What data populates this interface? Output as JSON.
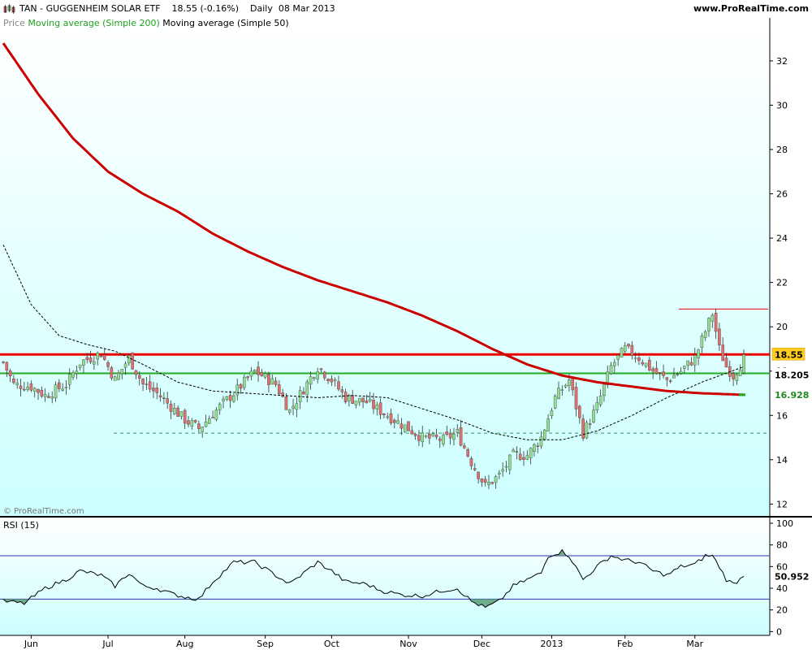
{
  "header": {
    "title": "TAN - GUGGENHEIM SOLAR ETF",
    "change": "18.55 (-0.16%)",
    "period": "Daily",
    "date": "08 Mar 2013",
    "brand": "www.ProRealTime.com"
  },
  "legend": {
    "price": "Price",
    "ma200": "Moving average (Simple 200)",
    "ma50": "Moving average (Simple 50)"
  },
  "watermark": "© ProRealTime.com",
  "colors": {
    "background_top": "#ffffff",
    "background_bottom": "#ccffff",
    "ma200": "#cc0000",
    "ma50": "#000000",
    "up_candle": "#90e090",
    "down_candle": "#e07070",
    "resistance": "#ee0000",
    "support": "#22aa22",
    "rsi_line": "#000000",
    "rsi_fill": "#5a9e7a"
  },
  "chart_data": [
    {
      "type": "candlestick",
      "name": "price",
      "y_ticks": [
        12,
        14,
        16,
        18,
        20,
        22,
        24,
        26,
        28,
        30,
        32
      ],
      "ylim": [
        11.5,
        33.5
      ],
      "x_ticks": [
        "Jun",
        "Jul",
        "Aug",
        "Sep",
        "Oct",
        "Nov",
        "Dec",
        "2013",
        "Feb",
        "Mar"
      ],
      "last_price": "18.55",
      "ma_label": "18.205",
      "support_label": "16.928",
      "closes_anchor": [
        [
          0,
          18.4
        ],
        [
          3,
          17.4
        ],
        [
          8,
          17.3
        ],
        [
          12,
          16.9
        ],
        [
          18,
          17.4
        ],
        [
          22,
          18.4
        ],
        [
          28,
          18.8
        ],
        [
          32,
          17.6
        ],
        [
          36,
          18.6
        ],
        [
          40,
          17.4
        ],
        [
          44,
          17.0
        ],
        [
          48,
          16.4
        ],
        [
          52,
          15.8
        ],
        [
          56,
          15.4
        ],
        [
          62,
          16.4
        ],
        [
          66,
          17.0
        ],
        [
          72,
          18.0
        ],
        [
          78,
          17.4
        ],
        [
          82,
          16.2
        ],
        [
          86,
          17.2
        ],
        [
          90,
          18.2
        ],
        [
          94,
          17.6
        ],
        [
          98,
          16.8
        ],
        [
          104,
          16.6
        ],
        [
          108,
          16.2
        ],
        [
          114,
          15.6
        ],
        [
          120,
          15.0
        ],
        [
          126,
          14.9
        ],
        [
          130,
          15.2
        ],
        [
          134,
          13.9
        ],
        [
          138,
          12.8
        ],
        [
          142,
          13.3
        ],
        [
          146,
          14.2
        ],
        [
          150,
          14.2
        ],
        [
          154,
          15.0
        ],
        [
          158,
          16.8
        ],
        [
          162,
          17.6
        ],
        [
          166,
          15.2
        ],
        [
          170,
          16.4
        ],
        [
          174,
          18.2
        ],
        [
          178,
          19.0
        ],
        [
          182,
          18.6
        ],
        [
          186,
          18.0
        ],
        [
          190,
          17.6
        ],
        [
          194,
          18.0
        ],
        [
          198,
          18.6
        ],
        [
          201,
          19.8
        ],
        [
          203,
          20.6
        ],
        [
          205,
          19.0
        ],
        [
          207,
          18.2
        ],
        [
          209,
          17.8
        ],
        [
          212,
          18.55
        ]
      ],
      "ma200": [
        [
          0,
          32.8
        ],
        [
          10,
          30.5
        ],
        [
          20,
          28.5
        ],
        [
          30,
          27.0
        ],
        [
          40,
          26.0
        ],
        [
          50,
          25.2
        ],
        [
          60,
          24.2
        ],
        [
          70,
          23.4
        ],
        [
          80,
          22.7
        ],
        [
          90,
          22.1
        ],
        [
          100,
          21.6
        ],
        [
          110,
          21.1
        ],
        [
          120,
          20.5
        ],
        [
          130,
          19.8
        ],
        [
          140,
          19.0
        ],
        [
          150,
          18.3
        ],
        [
          160,
          17.8
        ],
        [
          170,
          17.5
        ],
        [
          180,
          17.3
        ],
        [
          190,
          17.1
        ],
        [
          200,
          17.0
        ],
        [
          212,
          16.93
        ]
      ],
      "ma50": [
        [
          0,
          23.7
        ],
        [
          8,
          21.0
        ],
        [
          16,
          19.6
        ],
        [
          24,
          19.2
        ],
        [
          32,
          18.9
        ],
        [
          40,
          18.3
        ],
        [
          50,
          17.5
        ],
        [
          60,
          17.1
        ],
        [
          70,
          17.0
        ],
        [
          80,
          16.9
        ],
        [
          90,
          16.8
        ],
        [
          100,
          16.9
        ],
        [
          110,
          16.8
        ],
        [
          120,
          16.3
        ],
        [
          130,
          15.8
        ],
        [
          140,
          15.2
        ],
        [
          150,
          14.9
        ],
        [
          160,
          14.9
        ],
        [
          170,
          15.3
        ],
        [
          180,
          16.0
        ],
        [
          190,
          16.8
        ],
        [
          200,
          17.5
        ],
        [
          212,
          18.2
        ]
      ],
      "resistance": 18.75,
      "support": 17.9,
      "dashed_level": 15.2,
      "feb_high_marker": 20.8
    },
    {
      "type": "line",
      "name": "RSI (15)",
      "title": "RSI (15)",
      "y_ticks": [
        0,
        20,
        40,
        60,
        80,
        100
      ],
      "ylim": [
        -2,
        103
      ],
      "overbought": 70,
      "oversold": 30,
      "last_value": "50.952",
      "anchor": [
        [
          0,
          28
        ],
        [
          6,
          26
        ],
        [
          12,
          40
        ],
        [
          18,
          48
        ],
        [
          22,
          56
        ],
        [
          28,
          52
        ],
        [
          32,
          42
        ],
        [
          36,
          54
        ],
        [
          40,
          42
        ],
        [
          44,
          40
        ],
        [
          48,
          35
        ],
        [
          52,
          32
        ],
        [
          56,
          30
        ],
        [
          60,
          46
        ],
        [
          66,
          64
        ],
        [
          72,
          64
        ],
        [
          78,
          52
        ],
        [
          82,
          44
        ],
        [
          86,
          54
        ],
        [
          90,
          64
        ],
        [
          94,
          56
        ],
        [
          98,
          46
        ],
        [
          104,
          44
        ],
        [
          108,
          38
        ],
        [
          114,
          34
        ],
        [
          120,
          33
        ],
        [
          126,
          38
        ],
        [
          130,
          40
        ],
        [
          134,
          28
        ],
        [
          138,
          22
        ],
        [
          142,
          28
        ],
        [
          146,
          42
        ],
        [
          150,
          48
        ],
        [
          154,
          54
        ],
        [
          156,
          70
        ],
        [
          160,
          74
        ],
        [
          162,
          70
        ],
        [
          166,
          48
        ],
        [
          170,
          60
        ],
        [
          174,
          70
        ],
        [
          178,
          66
        ],
        [
          182,
          64
        ],
        [
          186,
          56
        ],
        [
          190,
          52
        ],
        [
          194,
          60
        ],
        [
          198,
          62
        ],
        [
          201,
          70
        ],
        [
          203,
          70
        ],
        [
          205,
          60
        ],
        [
          207,
          48
        ],
        [
          209,
          44
        ],
        [
          212,
          50.952
        ]
      ]
    }
  ]
}
